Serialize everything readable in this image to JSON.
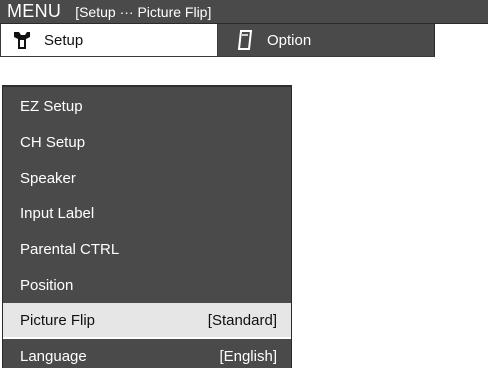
{
  "header": {
    "menu_label": "MENU",
    "breadcrumb": "[Setup ··· Picture Flip]"
  },
  "tabs": [
    {
      "label": "Setup",
      "icon": "setup-tool-icon",
      "active": true
    },
    {
      "label": "Option",
      "icon": "option-card-icon",
      "active": false
    }
  ],
  "menu": {
    "items": [
      {
        "label": "EZ Setup",
        "value": ""
      },
      {
        "label": "CH Setup",
        "value": ""
      },
      {
        "label": "Speaker",
        "value": ""
      },
      {
        "label": "Input Label",
        "value": ""
      },
      {
        "label": "Parental CTRL",
        "value": ""
      },
      {
        "label": "Position",
        "value": ""
      },
      {
        "label": "Picture Flip",
        "value": "[Standard]",
        "selected": true
      },
      {
        "label": "Language",
        "value": "[English]"
      }
    ]
  },
  "colors": {
    "panel_bg": "#4a4a4a",
    "selected_bg": "#e6e6e6",
    "active_tab_bg": "#ffffff",
    "text_light": "#ffffff",
    "text_dark": "#111111"
  }
}
